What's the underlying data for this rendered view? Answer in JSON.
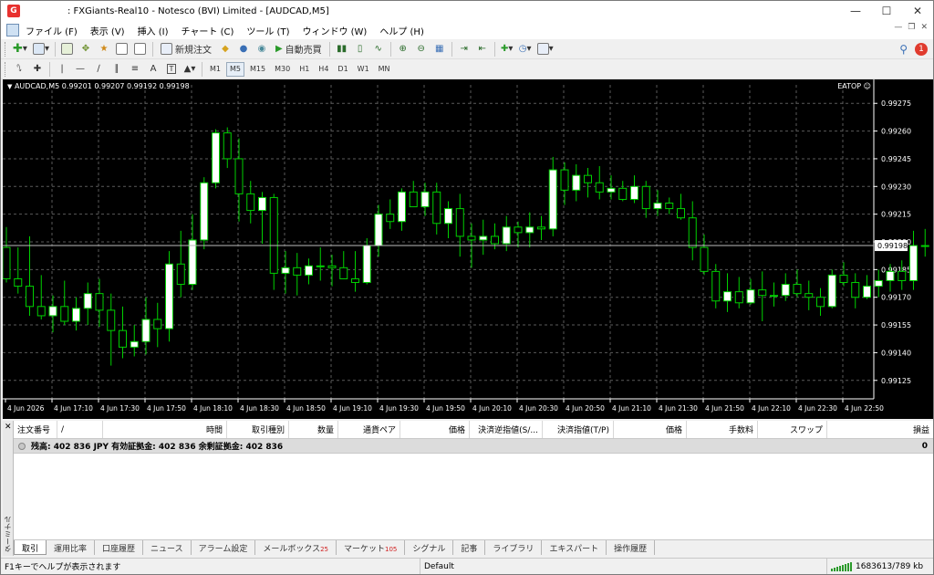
{
  "window": {
    "title": ": FXGiants-Real10 - Notesco (BVI) Limited - [AUDCAD,M5]",
    "app_icon_letter": "G"
  },
  "menu": [
    "ファイル (F)",
    "表示 (V)",
    "挿入 (I)",
    "チャート (C)",
    "ツール (T)",
    "ウィンドウ (W)",
    "ヘルプ (H)"
  ],
  "toolbar": {
    "new_order": "新規注文",
    "auto_trading": "自動売買",
    "notification_count": "1"
  },
  "timeframes": [
    "M1",
    "M5",
    "M15",
    "M30",
    "H1",
    "H4",
    "D1",
    "W1",
    "MN"
  ],
  "active_timeframe": "M5",
  "chart_caption": "AUDCAD,M5  0.99201 0.99207 0.99192 0.99198",
  "chart_ea": "EATOP",
  "chart_data": {
    "type": "candlestick",
    "symbol": "AUDCAD",
    "timeframe": "M5",
    "current_price": "0.99198",
    "ylim": [
      0.99115,
      0.99285
    ],
    "y_ticks": [
      "0.99275",
      "0.99260",
      "0.99245",
      "0.99230",
      "0.99215",
      "0.99200",
      "0.99185",
      "0.99170",
      "0.99155",
      "0.99140",
      "0.99125"
    ],
    "x_ticks": [
      "4 Jun 2026",
      "4 Jun 17:10",
      "4 Jun 17:30",
      "4 Jun 17:50",
      "4 Jun 18:10",
      "4 Jun 18:30",
      "4 Jun 18:50",
      "4 Jun 19:10",
      "4 Jun 19:30",
      "4 Jun 19:50",
      "4 Jun 20:10",
      "4 Jun 20:30",
      "4 Jun 20:50",
      "4 Jun 21:10",
      "4 Jun 21:30",
      "4 Jun 21:50",
      "4 Jun 22:10",
      "4 Jun 22:30",
      "4 Jun 22:50"
    ],
    "colors": {
      "bull": "#ffffff",
      "bear": "#000000",
      "wick": "#00d000",
      "grid": "#5a5a5a",
      "axis": "#ffffff"
    },
    "candles": [
      [
        0.99197,
        0.99208,
        0.99178,
        0.9918
      ],
      [
        0.9918,
        0.99197,
        0.99172,
        0.99176
      ],
      [
        0.99176,
        0.99203,
        0.9916,
        0.99165
      ],
      [
        0.99165,
        0.99182,
        0.99158,
        0.9916
      ],
      [
        0.9916,
        0.99171,
        0.99151,
        0.99165
      ],
      [
        0.99165,
        0.99179,
        0.99155,
        0.99157
      ],
      [
        0.99157,
        0.9917,
        0.99152,
        0.99164
      ],
      [
        0.99164,
        0.99178,
        0.99155,
        0.99172
      ],
      [
        0.99172,
        0.9918,
        0.99154,
        0.99163
      ],
      [
        0.99163,
        0.99172,
        0.99133,
        0.99152
      ],
      [
        0.99152,
        0.99165,
        0.99137,
        0.99143
      ],
      [
        0.99143,
        0.99155,
        0.99138,
        0.99146
      ],
      [
        0.99146,
        0.9917,
        0.99139,
        0.99158
      ],
      [
        0.99158,
        0.99167,
        0.99143,
        0.99153
      ],
      [
        0.99153,
        0.99195,
        0.99146,
        0.99188
      ],
      [
        0.99188,
        0.99206,
        0.9917,
        0.99177
      ],
      [
        0.99177,
        0.99215,
        0.99174,
        0.99201
      ],
      [
        0.99201,
        0.99235,
        0.99196,
        0.99232
      ],
      [
        0.99232,
        0.99261,
        0.99229,
        0.99259
      ],
      [
        0.99259,
        0.99262,
        0.9924,
        0.99245
      ],
      [
        0.99245,
        0.99256,
        0.99211,
        0.99226
      ],
      [
        0.99226,
        0.99233,
        0.9921,
        0.99217
      ],
      [
        0.99217,
        0.99227,
        0.99199,
        0.99224
      ],
      [
        0.99224,
        0.99226,
        0.99174,
        0.99183
      ],
      [
        0.99183,
        0.99195,
        0.99172,
        0.99186
      ],
      [
        0.99186,
        0.99194,
        0.99171,
        0.99182
      ],
      [
        0.99182,
        0.99191,
        0.99177,
        0.99187
      ],
      [
        0.99187,
        0.99197,
        0.99179,
        0.99187
      ],
      [
        0.99187,
        0.99193,
        0.99176,
        0.99186
      ],
      [
        0.99186,
        0.99195,
        0.9918,
        0.9918
      ],
      [
        0.9918,
        0.99195,
        0.99173,
        0.99178
      ],
      [
        0.99178,
        0.99202,
        0.99177,
        0.99198
      ],
      [
        0.99198,
        0.9922,
        0.99192,
        0.99215
      ],
      [
        0.99215,
        0.99223,
        0.99207,
        0.99211
      ],
      [
        0.99211,
        0.99229,
        0.99206,
        0.99227
      ],
      [
        0.99227,
        0.99233,
        0.9922,
        0.99219
      ],
      [
        0.99219,
        0.99232,
        0.99214,
        0.99227
      ],
      [
        0.99227,
        0.99232,
        0.99204,
        0.9921
      ],
      [
        0.9921,
        0.99222,
        0.99202,
        0.99218
      ],
      [
        0.99218,
        0.99226,
        0.99192,
        0.99203
      ],
      [
        0.99203,
        0.9921,
        0.99186,
        0.99201
      ],
      [
        0.99201,
        0.99212,
        0.99193,
        0.99203
      ],
      [
        0.99203,
        0.9921,
        0.99196,
        0.99199
      ],
      [
        0.99199,
        0.99214,
        0.99195,
        0.99208
      ],
      [
        0.99208,
        0.99211,
        0.99197,
        0.99205
      ],
      [
        0.99205,
        0.99216,
        0.99197,
        0.99208
      ],
      [
        0.99208,
        0.99214,
        0.99201,
        0.99207
      ],
      [
        0.99207,
        0.99246,
        0.99203,
        0.99239
      ],
      [
        0.99239,
        0.99243,
        0.9922,
        0.99228
      ],
      [
        0.99228,
        0.99242,
        0.99222,
        0.99236
      ],
      [
        0.99236,
        0.9924,
        0.99224,
        0.99232
      ],
      [
        0.99232,
        0.99241,
        0.99223,
        0.99227
      ],
      [
        0.99227,
        0.99236,
        0.99223,
        0.99229
      ],
      [
        0.99229,
        0.99233,
        0.99222,
        0.99223
      ],
      [
        0.99223,
        0.99236,
        0.99221,
        0.9923
      ],
      [
        0.9923,
        0.99233,
        0.99213,
        0.99218
      ],
      [
        0.99218,
        0.99228,
        0.99214,
        0.99221
      ],
      [
        0.99221,
        0.99224,
        0.99215,
        0.99218
      ],
      [
        0.99218,
        0.99226,
        0.99212,
        0.99213
      ],
      [
        0.99213,
        0.99222,
        0.9919,
        0.99197
      ],
      [
        0.99197,
        0.99204,
        0.99182,
        0.99184
      ],
      [
        0.99184,
        0.99188,
        0.99164,
        0.99168
      ],
      [
        0.99168,
        0.99183,
        0.99162,
        0.99173
      ],
      [
        0.99173,
        0.99181,
        0.99164,
        0.99167
      ],
      [
        0.99167,
        0.9918,
        0.99166,
        0.99174
      ],
      [
        0.99174,
        0.99184,
        0.99157,
        0.99171
      ],
      [
        0.99171,
        0.99178,
        0.99165,
        0.99171
      ],
      [
        0.99171,
        0.99183,
        0.99168,
        0.99177
      ],
      [
        0.99177,
        0.99185,
        0.9917,
        0.99172
      ],
      [
        0.99172,
        0.99179,
        0.99163,
        0.9917
      ],
      [
        0.9917,
        0.99175,
        0.9916,
        0.99165
      ],
      [
        0.99165,
        0.99185,
        0.99164,
        0.99182
      ],
      [
        0.99182,
        0.99189,
        0.99176,
        0.99178
      ],
      [
        0.99178,
        0.99183,
        0.99164,
        0.9917
      ],
      [
        0.9917,
        0.99182,
        0.99169,
        0.99176
      ],
      [
        0.99176,
        0.99185,
        0.9917,
        0.99179
      ],
      [
        0.99179,
        0.99188,
        0.99173,
        0.99184
      ],
      [
        0.99184,
        0.9919,
        0.99174,
        0.99179
      ],
      [
        0.99179,
        0.99206,
        0.99174,
        0.99198
      ],
      [
        0.99198,
        0.99207,
        0.99192,
        0.99198
      ]
    ]
  },
  "terminal": {
    "side_label": "ターミナル",
    "columns": [
      {
        "label": "注文番号",
        "align": "left"
      },
      {
        "label": "/",
        "align": "left"
      },
      {
        "label": "時間",
        "align": "right"
      },
      {
        "label": "取引種別",
        "align": "right"
      },
      {
        "label": "数量",
        "align": "right"
      },
      {
        "label": "通貨ペア",
        "align": "right"
      },
      {
        "label": "価格",
        "align": "right"
      },
      {
        "label": "決済逆指値(S/...",
        "align": "right"
      },
      {
        "label": "決済指値(T/P)",
        "align": "right"
      },
      {
        "label": "価格",
        "align": "right"
      },
      {
        "label": "手数料",
        "align": "right"
      },
      {
        "label": "スワップ",
        "align": "right"
      },
      {
        "label": "損益",
        "align": "right"
      }
    ],
    "balance_text": "残高: 402 836 JPY  有効証拠金: 402 836  余剰証拠金: 402 836",
    "profit": "0",
    "tabs": [
      {
        "label": "取引",
        "count": ""
      },
      {
        "label": "運用比率",
        "count": ""
      },
      {
        "label": "口座履歴",
        "count": ""
      },
      {
        "label": "ニュース",
        "count": ""
      },
      {
        "label": "アラーム設定",
        "count": ""
      },
      {
        "label": "メールボックス",
        "count": "25"
      },
      {
        "label": "マーケット",
        "count": "105"
      },
      {
        "label": "シグナル",
        "count": ""
      },
      {
        "label": "記事",
        "count": ""
      },
      {
        "label": "ライブラリ",
        "count": ""
      },
      {
        "label": "エキスパート",
        "count": ""
      },
      {
        "label": "操作履歴",
        "count": ""
      }
    ]
  },
  "status": {
    "help": "F1キーでヘルプが表示されます",
    "profile": "Default",
    "traffic": "1683613/789 kb"
  }
}
